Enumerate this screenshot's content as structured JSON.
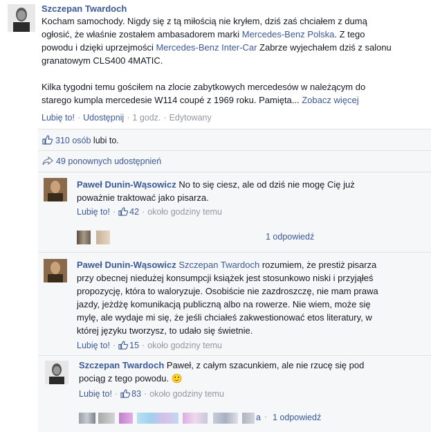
{
  "post": {
    "author": "Szczepan Twardoch",
    "line1_a": "Kocham samochody. Nigdy się z tą miłością nie kryłem, dziś zaś chciałem z dumą",
    "line2_a": "ogłosić, że właśnie zostałem ambasadorem marki ",
    "line2_link": "Mercedes-Benz Polska",
    "line2_b": ". Z tego",
    "line3_a": "powodu i dzięki uprzejmości ",
    "line3_link": "Mercedes-Benz Inter-Car",
    "line3_b": " Zabrze wyjechałem dziś z salonu",
    "line4": "granatowym CLS400 4MATIC.",
    "line5": "Kilka tygodni temu gościłem na zlocie zabytkowych mercedesów w należącym do",
    "line6_a": "starego kumpla mercedesie W114 coupé z 1969 roku. Pamięta... ",
    "see_more": "Zobacz więcej"
  },
  "actions": {
    "like": "Lubię to!",
    "share": "Udostępnij",
    "time": "1 godz.",
    "edited": "Edytowany"
  },
  "likes": {
    "count_link": "310 osób",
    "suffix": "lubi to."
  },
  "shares": {
    "text": "49 ponownych udostępnień"
  },
  "comments": [
    {
      "author": "Paweł Dunin-Wąsowicz",
      "text_a": " No to się ciesz, ale od dziś nie mogę Cię już",
      "text_b": "poważnie traktować jako pisarza.",
      "like": "Lubię to!",
      "likes": "42",
      "time": "około godziny temu",
      "replies": "1 odpowiedź"
    },
    {
      "author": "Paweł Dunin-Wąsowicz",
      "mention": "Szczepan Twardoch",
      "text_1": " rozumiem, że prestiż pisarza",
      "text_2": "przy obecnej niedużej konsumpcji książek jest stosunkowo niski i przyjąłeś",
      "text_3": "propozycję, która to waloryzuje. Osobiście nie zazdroszczę, nie mam prawa",
      "text_4": "jazdy, jeżdżę komunikacją publiczną albo na rowerze. Nie wiem, może się",
      "text_5": "mylę, ale wydaje mi się, że jeśli chciałeś zakwestionować etos literatury, w",
      "text_6": "której języku tworzysz, to udało się świetnie.",
      "like": "Lubię to!",
      "likes": "15",
      "time": "około godziny temu"
    },
    {
      "author": "Szczepan Twardoch",
      "text_a": " Paweł, z całym szacunkiem, ale nie rzucę się pod",
      "text_b": "pociąg z tego powodu. ",
      "emoji": "🙂",
      "like": "Lubię to!",
      "likes": "83",
      "time": "około godziny temu",
      "replies_prefix": "a",
      "replies": "1 odpowiedź"
    }
  ],
  "colors": {
    "link": "#3b5998",
    "meta": "#9197a3",
    "ufi_bg": "#f6f7f8"
  },
  "icons": [
    "thumbs-up-icon",
    "share-arrow-icon",
    "smile-emoji"
  ]
}
